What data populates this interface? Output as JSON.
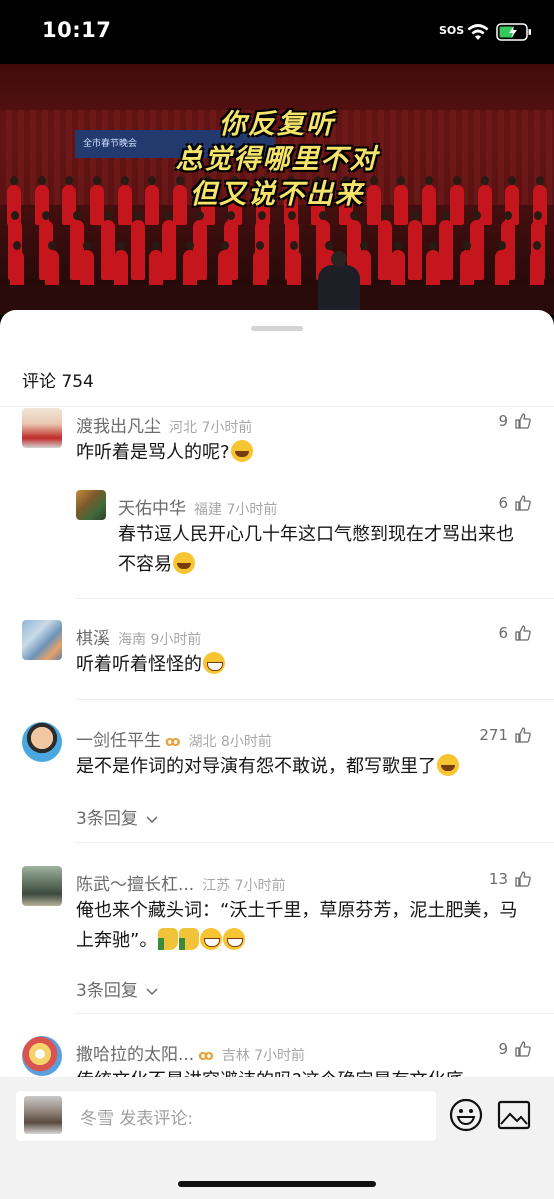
{
  "status": {
    "time": "10:17",
    "sos": "SOS"
  },
  "video": {
    "captions": [
      "你反复听",
      "总觉得哪里不对",
      "但又说不出来"
    ],
    "banner_text": "全市春节晚会"
  },
  "comments_panel": {
    "title": "评论 754",
    "comments": [
      {
        "name": "渡我出凡尘",
        "location": "河北 7小时前",
        "likes": "9",
        "text": "咋听着是骂人的呢?"
      },
      {
        "name": "天佑中华",
        "location": "福建 7小时前",
        "likes": "6",
        "text": "春节逗人民开心几十年这口气憋到现在才骂出来也不容易",
        "is_reply": true
      },
      {
        "name": "棋溪",
        "location": "海南 9小时前",
        "likes": "6",
        "text": "听着听着怪怪的"
      },
      {
        "name": "一剑任平生",
        "location": "湖北 8小时前",
        "likes": "271",
        "text": "是不是作词的对导演有怨不敢说，都写歌里了",
        "replies": "3条回复",
        "badge": "ꝏ"
      },
      {
        "name": "陈武～擅长杠...",
        "location": "江苏 7小时前",
        "likes": "13",
        "text": "俺也来个藏头词：“沃土千里，草原芬芳，泥土肥美，马上奔驰”。",
        "replies": "3条回复"
      },
      {
        "name": "撒哈拉的太阳...",
        "location": "吉林 7小时前",
        "likes": "9",
        "text": "传统文化不是讲究避讳的吗?这个确定是有文化底",
        "badge": "ꝏ"
      }
    ]
  },
  "input": {
    "author": "冬雪",
    "placeholder": "发表评论:"
  },
  "colors": {
    "name_gray": "#6b6b6b",
    "badge_gold": "#e6a23c",
    "caption_yellow": "#f5e36a"
  },
  "icons": [
    "wifi-icon",
    "battery-icon",
    "thumb-up-icon",
    "chevron-down-icon",
    "emoji-icon",
    "image-icon"
  ]
}
